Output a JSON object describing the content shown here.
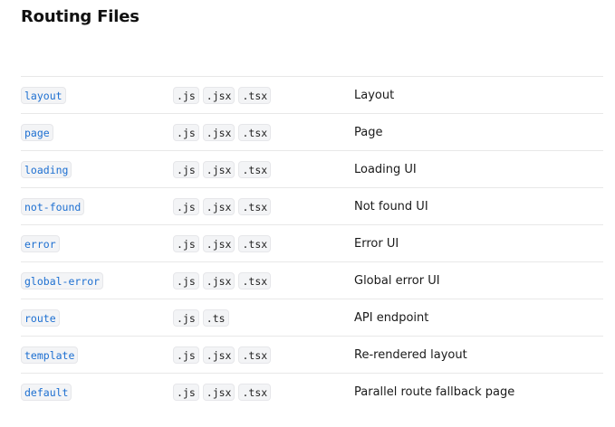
{
  "page": {
    "title": "Routing Files"
  },
  "rows": [
    {
      "file": "layout",
      "exts": [
        ".js",
        ".jsx",
        ".tsx"
      ],
      "desc": "Layout"
    },
    {
      "file": "page",
      "exts": [
        ".js",
        ".jsx",
        ".tsx"
      ],
      "desc": "Page"
    },
    {
      "file": "loading",
      "exts": [
        ".js",
        ".jsx",
        ".tsx"
      ],
      "desc": "Loading UI"
    },
    {
      "file": "not-found",
      "exts": [
        ".js",
        ".jsx",
        ".tsx"
      ],
      "desc": "Not found UI"
    },
    {
      "file": "error",
      "exts": [
        ".js",
        ".jsx",
        ".tsx"
      ],
      "desc": "Error UI"
    },
    {
      "file": "global-error",
      "exts": [
        ".js",
        ".jsx",
        ".tsx"
      ],
      "desc": "Global error UI"
    },
    {
      "file": "route",
      "exts": [
        ".js",
        ".ts"
      ],
      "desc": "API endpoint"
    },
    {
      "file": "template",
      "exts": [
        ".js",
        ".jsx",
        ".tsx"
      ],
      "desc": "Re-rendered layout"
    },
    {
      "file": "default",
      "exts": [
        ".js",
        ".jsx",
        ".tsx"
      ],
      "desc": "Parallel route fallback page"
    }
  ],
  "colors": {
    "file_code": "#1d6fd1",
    "code_bg": "#f3f4f6",
    "divider": "#e8e8e8"
  }
}
